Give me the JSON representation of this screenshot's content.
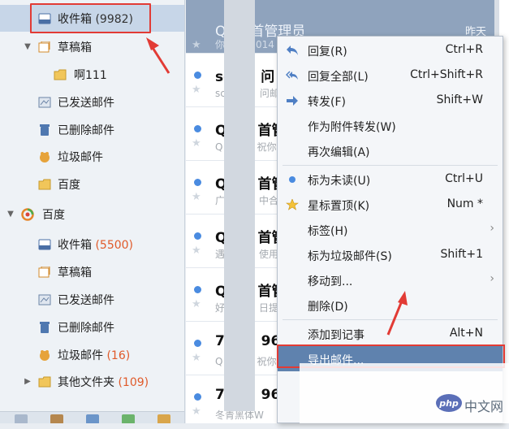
{
  "sidebar": {
    "account1": [
      {
        "label": "收件箱",
        "count": "(9982)",
        "icon": "inbox-icon"
      },
      {
        "label": "草稿箱",
        "icon": "drafts-icon"
      },
      {
        "label": "啊111",
        "icon": "folder-icon"
      },
      {
        "label": "已发送邮件",
        "icon": "sent-icon"
      },
      {
        "label": "已删除邮件",
        "icon": "trash-icon"
      },
      {
        "label": "垃圾邮件",
        "icon": "junk-icon"
      },
      {
        "label": "百度",
        "icon": "folder-icon"
      }
    ],
    "account2_label": "百度",
    "account2": [
      {
        "label": "收件箱",
        "count": "(5500)",
        "icon": "inbox-icon"
      },
      {
        "label": "草稿箱",
        "icon": "drafts-icon"
      },
      {
        "label": "已发送邮件",
        "icon": "sent-icon"
      },
      {
        "label": "已删除邮件",
        "icon": "trash-icon"
      },
      {
        "label": "垃圾邮件",
        "count": "(16)",
        "icon": "junk-icon"
      },
      {
        "label": "其他文件夹",
        "count": "(109)",
        "icon": "folder-icon"
      }
    ]
  },
  "maillist": {
    "rows": [
      {
        "sender": "Q",
        "sender_tail": "首管理员",
        "preview": "你",
        "preview_tail": "014",
        "date": "昨天",
        "selected": true
      },
      {
        "sender": "sc",
        "sender_tail": "问",
        "preview": "sc",
        "preview_tail": "问邮"
      },
      {
        "sender": "Q",
        "sender_tail": "首管",
        "preview": "Q",
        "preview_tail": "祝你"
      },
      {
        "sender": "Q",
        "sender_tail": "首管",
        "preview": "广",
        "preview_tail": "中合"
      },
      {
        "sender": "Q",
        "sender_tail": "首管",
        "preview": "遇",
        "preview_tail": "使用"
      },
      {
        "sender": "Q",
        "sender_tail": "首管",
        "preview": "好",
        "preview_tail": "日提"
      },
      {
        "sender": "70",
        "sender_tail": "965",
        "preview": "Q",
        "preview_tail": "祝你"
      },
      {
        "sender": "70",
        "sender_tail": "965",
        "preview": "冬青黑体W",
        "preview_tail": ""
      }
    ]
  },
  "context_menu": {
    "items": [
      {
        "label": "回复(R)",
        "shortcut": "Ctrl+R",
        "icon": "reply-icon"
      },
      {
        "label": "回复全部(L)",
        "shortcut": "Ctrl+Shift+R",
        "icon": "reply-all-icon"
      },
      {
        "label": "转发(F)",
        "shortcut": "Shift+W",
        "icon": "forward-icon"
      },
      {
        "label": "作为附件转发(W)",
        "shortcut": "",
        "icon": ""
      },
      {
        "label": "再次编辑(A)",
        "shortcut": "",
        "icon": ""
      },
      {
        "label": "标为未读(U)",
        "shortcut": "Ctrl+U",
        "icon": "unread-dot-icon"
      },
      {
        "label": "星标置顶(K)",
        "shortcut": "Num *",
        "icon": "star-icon"
      },
      {
        "label": "标签(H)",
        "shortcut": "",
        "icon": "",
        "submenu": true
      },
      {
        "label": "标为垃圾邮件(S)",
        "shortcut": "Shift+1",
        "icon": ""
      },
      {
        "label": "移动到...",
        "shortcut": "",
        "icon": "",
        "submenu": true
      },
      {
        "label": "删除(D)",
        "shortcut": "",
        "icon": ""
      },
      {
        "label": "添加到记事",
        "shortcut": "Alt+N",
        "icon": ""
      },
      {
        "label": "导出邮件...",
        "shortcut": "",
        "icon": "",
        "highlighted": true
      }
    ]
  },
  "watermark": {
    "logo": "php",
    "text": "中文网"
  },
  "colors": {
    "accent_red": "#e23b35",
    "count_orange": "#e05a2a",
    "selection_blue": "#5f82ae",
    "unread_blue": "#4a8be0"
  }
}
